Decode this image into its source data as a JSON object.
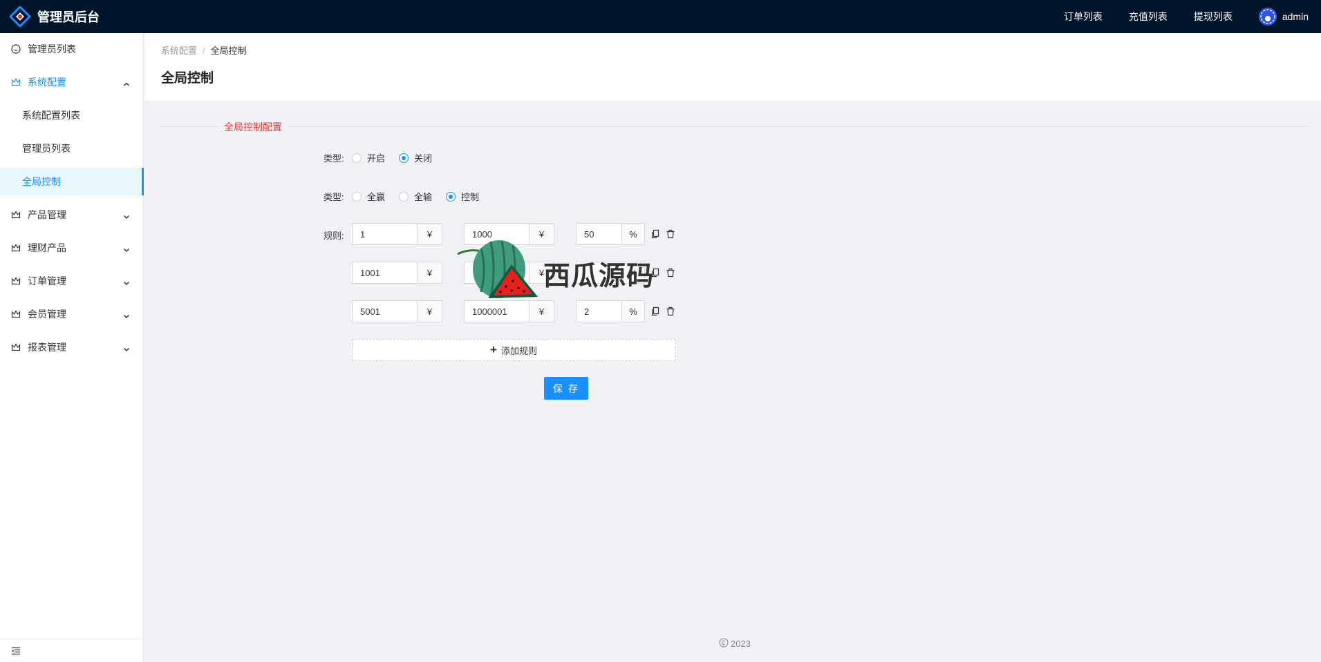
{
  "app": {
    "title": "管理员后台"
  },
  "topnav": {
    "orders": "订单列表",
    "recharge": "充值列表",
    "withdraw": "提现列表",
    "user": "admin"
  },
  "sidebar": {
    "items": [
      {
        "label": "管理员列表"
      },
      {
        "label": "系统配置"
      },
      {
        "label": "系统配置列表"
      },
      {
        "label": "管理员列表"
      },
      {
        "label": "全局控制"
      },
      {
        "label": "产品管理"
      },
      {
        "label": "理财产品"
      },
      {
        "label": "订单管理"
      },
      {
        "label": "会员管理"
      },
      {
        "label": "报表管理"
      }
    ]
  },
  "breadcrumb": {
    "parent": "系统配置",
    "sep": "/",
    "current": "全局控制"
  },
  "page": {
    "title": "全局控制"
  },
  "form": {
    "section_title": "全局控制配置",
    "switch": {
      "label": "类型:",
      "options": [
        "开启",
        "关闭"
      ],
      "selected": "关闭"
    },
    "mode": {
      "label": "类型:",
      "options": [
        "全赢",
        "全输",
        "控制"
      ],
      "selected": "控制"
    },
    "rules_label": "规则:",
    "currency": "¥",
    "percent": "%",
    "rules": [
      {
        "min": "1",
        "max": "1000",
        "rate": "50"
      },
      {
        "min": "1001",
        "max": "",
        "rate": ""
      },
      {
        "min": "5001",
        "max": "1000001",
        "rate": "2"
      }
    ],
    "add_rule": "添加规则",
    "save": "保 存"
  },
  "watermark": {
    "text": "西瓜源码"
  },
  "footer": {
    "copyright": "2023"
  },
  "colors": {
    "header_bg": "#001529",
    "primary": "#1890ff",
    "section_title": "#e53935"
  }
}
